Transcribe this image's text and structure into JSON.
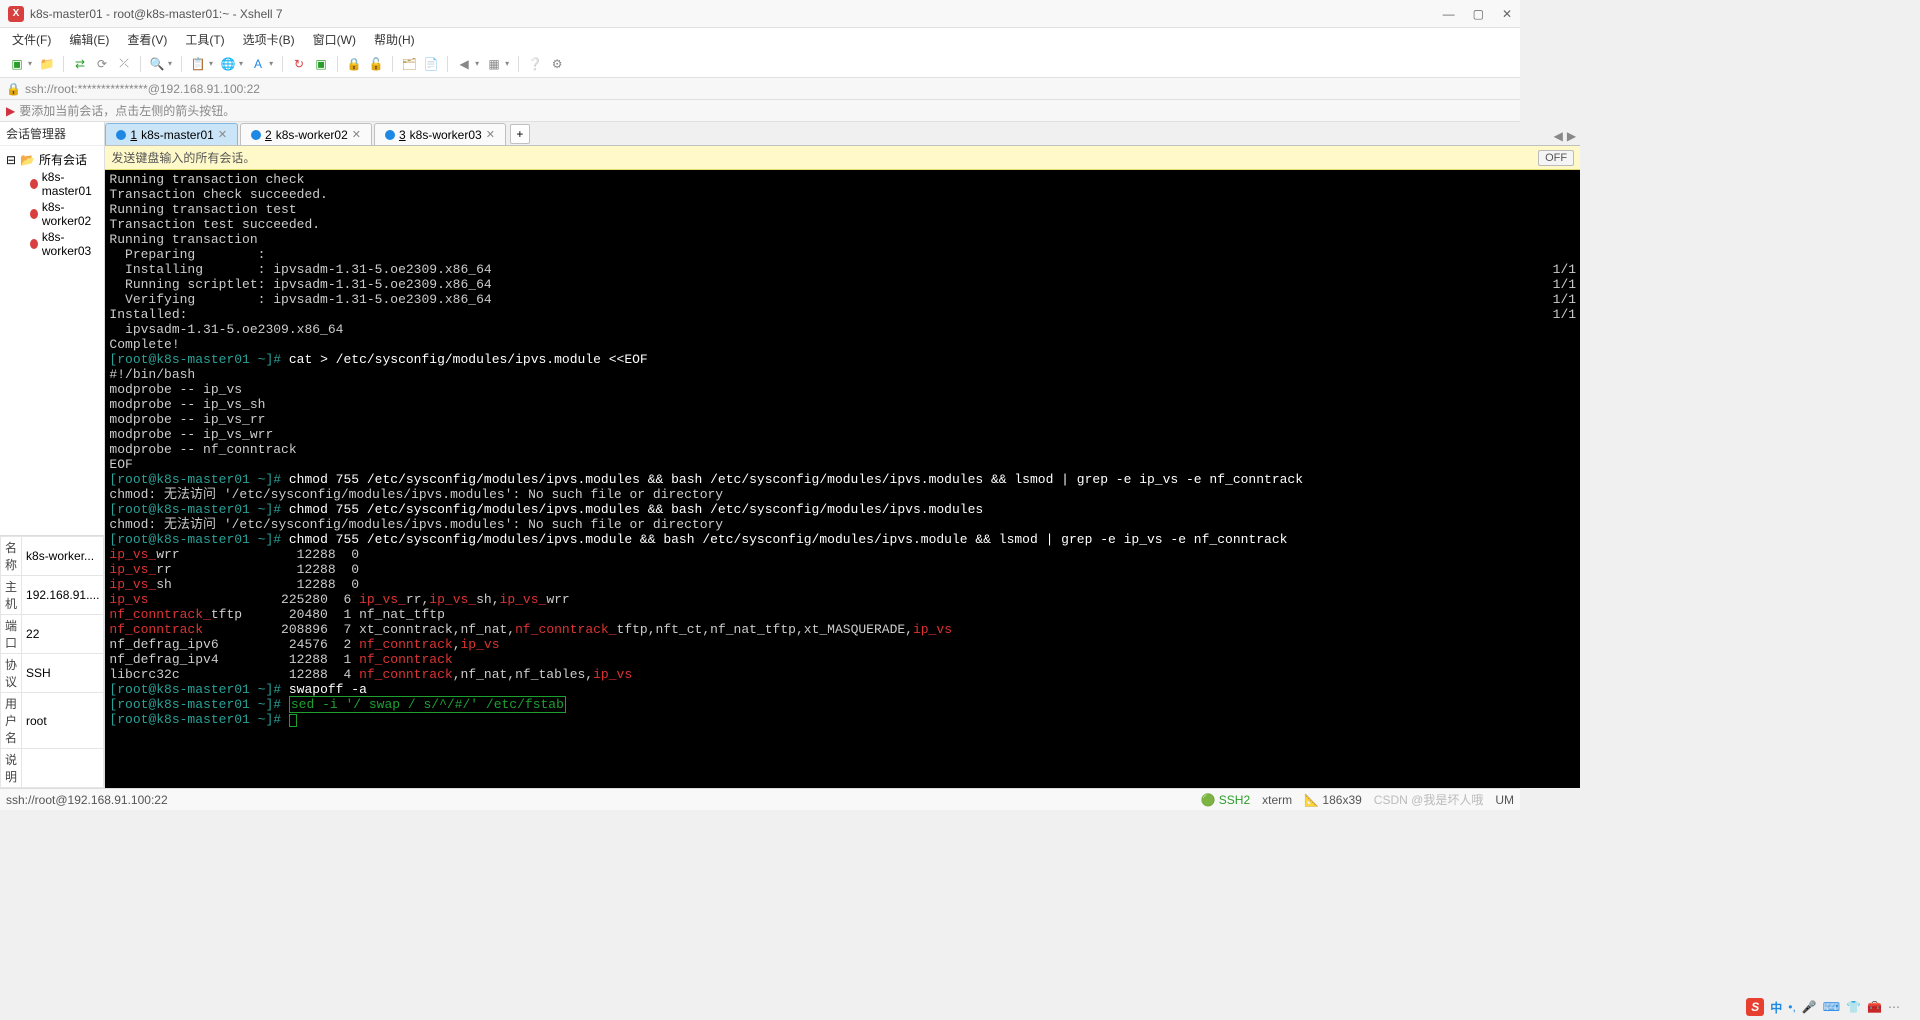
{
  "window": {
    "title": "k8s-master01 - root@k8s-master01:~ - Xshell 7",
    "min": "—",
    "max": "▢",
    "close": "✕"
  },
  "menu": {
    "file": "文件(F)",
    "edit": "编辑(E)",
    "view": "查看(V)",
    "tools": "工具(T)",
    "tabs": "选项卡(B)",
    "window": "窗口(W)",
    "help": "帮助(H)"
  },
  "address": "ssh://root:***************@192.168.91.100:22",
  "hint": "要添加当前会话，点击左侧的箭头按钮。",
  "sidebar": {
    "header": "会话管理器",
    "root": "所有会话",
    "items": [
      "k8s-master01",
      "k8s-worker02",
      "k8s-worker03"
    ]
  },
  "tabs": [
    {
      "num": "1",
      "label": "k8s-master01",
      "active": true
    },
    {
      "num": "2",
      "label": "k8s-worker02",
      "active": false
    },
    {
      "num": "3",
      "label": "k8s-worker03",
      "active": false
    }
  ],
  "broadcast": {
    "text": "发送键盘输入的所有会话。",
    "btn": "OFF"
  },
  "props": {
    "name_label": "名称",
    "name_value": "k8s-worker...",
    "host_label": "主机",
    "host_value": "192.168.91....",
    "port_label": "端口",
    "port_value": "22",
    "proto_label": "协议",
    "proto_value": "SSH",
    "user_label": "用户名",
    "user_value": "root",
    "desc_label": "说明",
    "desc_value": ""
  },
  "terminal": {
    "lines": [
      {
        "t": "Running transaction check"
      },
      {
        "t": "Transaction check succeeded."
      },
      {
        "t": "Running transaction test"
      },
      {
        "t": "Transaction test succeeded."
      },
      {
        "t": "Running transaction"
      },
      {
        "t": "  Preparing        :                                                                                                                                                                       ",
        "r": "1/1"
      },
      {
        "t": "  Installing       : ipvsadm-1.31-5.oe2309.x86_64                                                                                                                                           ",
        "r": "1/1"
      },
      {
        "t": "  Running scriptlet: ipvsadm-1.31-5.oe2309.x86_64                                                                                                                                           ",
        "r": "1/1"
      },
      {
        "t": "  Verifying        : ipvsadm-1.31-5.oe2309.x86_64                                                                                                                                           ",
        "r": "1/1"
      },
      {
        "t": ""
      },
      {
        "t": "Installed:"
      },
      {
        "t": "  ipvsadm-1.31-5.oe2309.x86_64"
      },
      {
        "t": ""
      },
      {
        "t": "Complete!"
      },
      {
        "prompt": "[root@k8s-master01 ~]# ",
        "cmd": "cat > /etc/sysconfig/modules/ipvs.module <<EOF"
      },
      {
        "t": "#!/bin/bash"
      },
      {
        "t": "modprobe -- ip_vs"
      },
      {
        "t": "modprobe -- ip_vs_sh"
      },
      {
        "t": "modprobe -- ip_vs_rr"
      },
      {
        "t": "modprobe -- ip_vs_wrr"
      },
      {
        "t": "modprobe -- nf_conntrack"
      },
      {
        "t": "EOF"
      },
      {
        "prompt": "[root@k8s-master01 ~]# ",
        "cmd": "chmod 755 /etc/sysconfig/modules/ipvs.modules && bash /etc/sysconfig/modules/ipvs.modules && lsmod | grep -e ip_vs -e nf_conntrack"
      },
      {
        "t": "chmod: 无法访问 '/etc/sysconfig/modules/ipvs.modules': No such file or directory"
      },
      {
        "prompt": "[root@k8s-master01 ~]# ",
        "cmd": "chmod 755 /etc/sysconfig/modules/ipvs.modules && bash /etc/sysconfig/modules/ipvs.modules"
      },
      {
        "t": "chmod: 无法访问 '/etc/sysconfig/modules/ipvs.modules': No such file or directory"
      },
      {
        "prompt": "[root@k8s-master01 ~]# ",
        "cmd": "chmod 755 /etc/sysconfig/modules/ipvs.module && bash /etc/sysconfig/modules/ipvs.module && lsmod | grep -e ip_vs -e nf_conntrack"
      },
      {
        "mod": [
          {
            "h": "ip_vs_"
          },
          {
            "p": "wrr               12288  0"
          }
        ]
      },
      {
        "mod": [
          {
            "h": "ip_vs_"
          },
          {
            "p": "rr                12288  0"
          }
        ]
      },
      {
        "mod": [
          {
            "h": "ip_vs_"
          },
          {
            "p": "sh                12288  0"
          }
        ]
      },
      {
        "mod": [
          {
            "h": "ip_vs"
          },
          {
            "p": "                 225280  6 "
          },
          {
            "h": "ip_vs_"
          },
          {
            "p": "rr,"
          },
          {
            "h": "ip_vs_"
          },
          {
            "p": "sh,"
          },
          {
            "h": "ip_vs_"
          },
          {
            "p": "wrr"
          }
        ]
      },
      {
        "mod": [
          {
            "h": "nf_conntrack_"
          },
          {
            "p": "tftp      20480  1 nf_nat_tftp"
          }
        ]
      },
      {
        "mod": [
          {
            "h": "nf_conntrack"
          },
          {
            "p": "          208896  7 xt_conntrack,nf_nat,"
          },
          {
            "h": "nf_conntrack_"
          },
          {
            "p": "tftp,nft_ct,nf_nat_tftp,xt_MASQUERADE,"
          },
          {
            "h": "ip_vs"
          }
        ]
      },
      {
        "mod": [
          {
            "p": "nf_defrag_ipv6         24576  2 "
          },
          {
            "h": "nf_conntrack"
          },
          {
            "p": ","
          },
          {
            "h": "ip_vs"
          }
        ]
      },
      {
        "mod": [
          {
            "p": "nf_defrag_ipv4         12288  1 "
          },
          {
            "h": "nf_conntrack"
          }
        ]
      },
      {
        "mod": [
          {
            "p": "libcrc32c              12288  4 "
          },
          {
            "h": "nf_conntrack"
          },
          {
            "p": ",nf_nat,nf_tables,"
          },
          {
            "h": "ip_vs"
          }
        ]
      },
      {
        "prompt": "[root@k8s-master01 ~]# ",
        "cmd": "swapoff -a"
      },
      {
        "prompt": "[root@k8s-master01 ~]# ",
        "boxcmd": "sed -i '/ swap / s/^/#/' /etc/fstab"
      },
      {
        "prompt": "[root@k8s-master01 ~]# ",
        "cursor": true
      }
    ]
  },
  "status": {
    "left": "ssh://root@192.168.91.100:22",
    "ssh": "SSH2",
    "term": "xterm",
    "size": "186x39",
    "csdn": "CSDN @我是坏人哦",
    "caps": "UM"
  },
  "ime": {
    "zh": "中"
  }
}
